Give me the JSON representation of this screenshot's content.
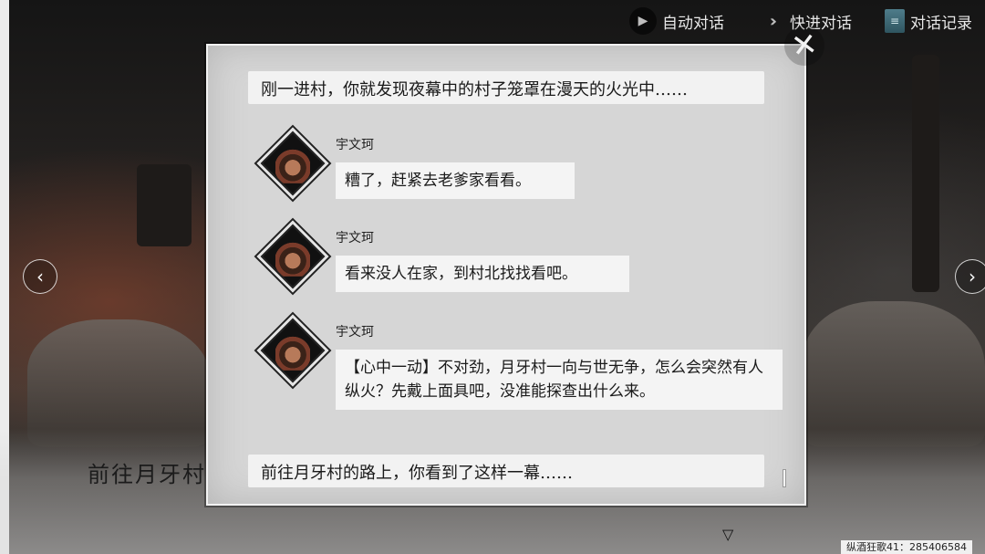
{
  "topbar": {
    "auto_label": "自动对话",
    "fast_label": "快进对话",
    "log_label": "对话记录"
  },
  "icons": {
    "auto": "play-icon",
    "fast": "fast-forward-icon",
    "log": "book-icon",
    "close": "close-icon",
    "nav_prev": "chevron-left-icon",
    "nav_next": "chevron-right-icon",
    "more": "triangle-down-icon"
  },
  "nav": {
    "prev": "‹",
    "next": "›"
  },
  "close_glyph": "✕",
  "scene_caption": "前往月牙村",
  "log": {
    "narration_top": "刚一进村，你就发现夜幕中的村子笼罩在漫天的火光中……",
    "messages": [
      {
        "speaker": "宇文珂",
        "text": "糟了，赶紧去老爹家看看。"
      },
      {
        "speaker": "宇文珂",
        "text": "看来没人在家，到村北找找看吧。"
      },
      {
        "speaker": "宇文珂",
        "text": "【心中一动】不对劲，月牙村一向与世无争，怎么会突然有人纵火？先戴上面具吧，没准能探查出什么来。"
      }
    ],
    "narration_bottom": "前往月牙村的路上，你看到了这样一幕……"
  },
  "more_indicator": "▽",
  "footer_tag": "纵酒狂歌41：285406584",
  "colors": {
    "panel_bg": "#d6d6d6",
    "bubble_bg": "#f4f4f4",
    "scene_glow": "#96462d"
  }
}
